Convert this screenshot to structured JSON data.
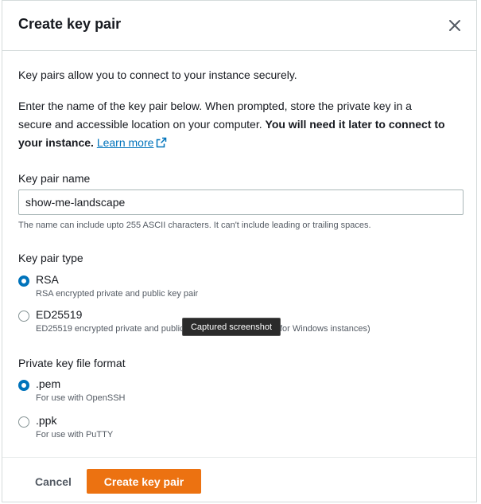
{
  "modal": {
    "title": "Create key pair",
    "intro": "Key pairs allow you to connect to your instance securely.",
    "instructions": {
      "text": "Enter the name of the key pair below. When prompted, store the private key in a secure and accessible location on your computer. ",
      "bold": "You will need it later to connect to your instance.",
      "link": "Learn more"
    }
  },
  "key_pair_name": {
    "label": "Key pair name",
    "value": "show-me-landscape",
    "hint": "The name can include upto 255 ASCII characters. It can't include leading or trailing spaces."
  },
  "key_pair_type": {
    "label": "Key pair type",
    "options": [
      {
        "label": "RSA",
        "desc": "RSA encrypted private and public key pair",
        "checked": true
      },
      {
        "label": "ED25519",
        "desc": "ED25519 encrypted private and public key pair (Not supported for Windows instances)",
        "checked": false
      }
    ]
  },
  "file_format": {
    "label": "Private key file format",
    "options": [
      {
        "label": ".pem",
        "desc": "For use with OpenSSH",
        "checked": true
      },
      {
        "label": ".ppk",
        "desc": "For use with PuTTY",
        "checked": false
      }
    ]
  },
  "footer": {
    "cancel": "Cancel",
    "create": "Create key pair"
  },
  "tooltip": "Captured screenshot",
  "colors": {
    "primary": "#ec7211",
    "link": "#0073bb",
    "radio_checked": "#0073bb"
  }
}
